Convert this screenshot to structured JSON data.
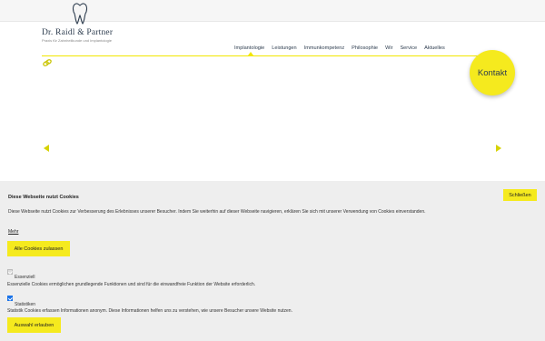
{
  "header": {
    "logo_name": "Dr. Raidl & Partner",
    "logo_subtitle": "Praxis für Zahnheilkunde und Implantologie"
  },
  "nav": {
    "items": [
      {
        "label": "Implantologie",
        "active": true
      },
      {
        "label": "Leistungen"
      },
      {
        "label": "Immunkompetenz"
      },
      {
        "label": "Philosophie"
      },
      {
        "label": "Wir"
      },
      {
        "label": "Service"
      },
      {
        "label": "Aktuelles"
      }
    ]
  },
  "kontakt_label": "Kontakt",
  "colors": {
    "accent": "#f5ea1e",
    "nav_text": "#2e3d4f",
    "panel_bg": "#eeeeee"
  },
  "cookie": {
    "title": "Diese Webseite nutzt Cookies",
    "text": "Diese Webseite nutzt Cookies zur Verbesserung des Erlebnisses unserer Besucher. Indem Sie weiterhin auf dieser Webseite navigieren, erklären Sie sich mit unserer Verwendung von Cookies einverstanden.",
    "more_label": "Mehr",
    "close_label": "Schließen",
    "allow_all_label": "Alle Cookies zulassen",
    "allow_selected_label": "Auswahl erlauben",
    "options": [
      {
        "label": "Essenziell",
        "description": "Essenzielle Cookies ermöglichen grundlegende Funktionen und sind für die einwandfreie Funktion der Website erforderlich.",
        "checked": true,
        "disabled": true
      },
      {
        "label": "Statistiken",
        "description": "Statistik Cookies erfassen Informationen anonym. Diese Informationen helfen uns zu verstehen, wie unsere Besucher unsere Website nutzen.",
        "checked": true,
        "disabled": false
      }
    ]
  }
}
